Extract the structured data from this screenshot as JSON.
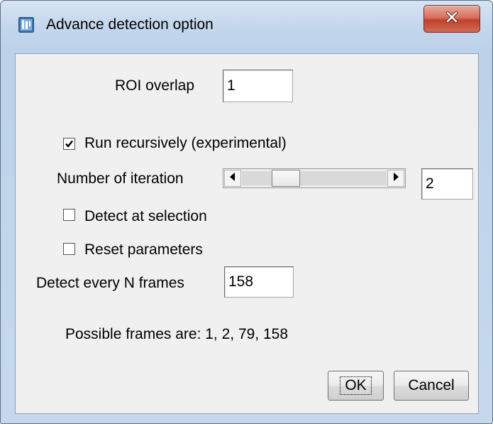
{
  "window": {
    "title": "Advance detection option",
    "icons": {
      "app": "imagej-app-icon",
      "close": "close-icon"
    },
    "colors": {
      "close_button": "#c9503b",
      "frame": "#bcd2e9",
      "panel": "#f0f0f0"
    }
  },
  "form": {
    "roi_overlap": {
      "label": "ROI overlap",
      "value": "1"
    },
    "run_recursively": {
      "label": "Run recursively (experimental)",
      "checked": true
    },
    "iterations": {
      "label": "Number of iteration",
      "value": "2",
      "slider_position": 0.33
    },
    "detect_at_selection": {
      "label": "Detect at selection",
      "checked": false
    },
    "reset_parameters": {
      "label": "Reset parameters",
      "checked": false
    },
    "detect_every_n_frames": {
      "label": "Detect every N frames",
      "value": "158"
    },
    "possible_frames_message": "Possible frames are: 1, 2, 79, 158"
  },
  "buttons": {
    "ok": "OK",
    "cancel": "Cancel"
  }
}
